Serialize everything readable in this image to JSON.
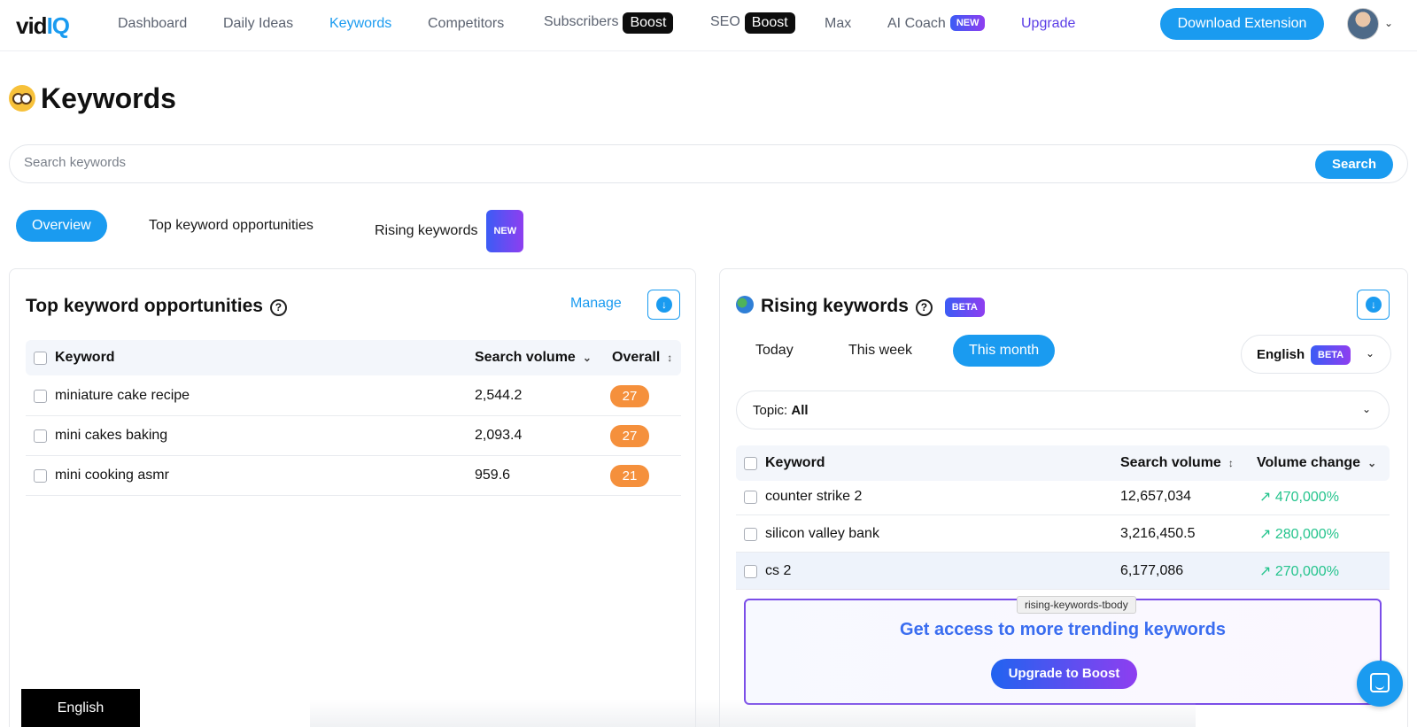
{
  "nav": {
    "logo_a": "vid",
    "logo_b": "IQ",
    "items": [
      {
        "label": "Dashboard"
      },
      {
        "label": "Daily Ideas"
      },
      {
        "label": "Keywords"
      },
      {
        "label": "Competitors"
      },
      {
        "label": "Subscribers",
        "pill": "Boost"
      },
      {
        "label": "SEO",
        "pill": "Boost"
      },
      {
        "label": "Max"
      },
      {
        "label": "AI Coach",
        "pill": "NEW"
      },
      {
        "label": "Upgrade"
      }
    ],
    "download_button": "Download Extension"
  },
  "page": {
    "title": "Keywords"
  },
  "search": {
    "placeholder": "Search keywords",
    "button": "Search"
  },
  "tabs": [
    {
      "label": "Overview",
      "active": true
    },
    {
      "label": "Top keyword opportunities"
    },
    {
      "label": "Rising keywords",
      "pill": "NEW"
    }
  ],
  "left_card": {
    "title": "Top keyword opportunities",
    "help": "?",
    "manage": "Manage",
    "columns": [
      "Keyword",
      "Search volume",
      "Overall"
    ],
    "rows": [
      {
        "keyword": "miniature cake recipe",
        "volume": "2,544.2",
        "score": "27"
      },
      {
        "keyword": "mini cakes baking",
        "volume": "2,093.4",
        "score": "27"
      },
      {
        "keyword": "mini cooking asmr",
        "volume": "959.6",
        "score": "21"
      }
    ]
  },
  "right_card": {
    "title": "Rising keywords",
    "help": "?",
    "beta": "BETA",
    "periods": [
      "Today",
      "This week",
      "This month"
    ],
    "language": {
      "label": "English",
      "beta": "BETA"
    },
    "topic": {
      "label": "Topic:",
      "value": "All"
    },
    "columns": [
      "Keyword",
      "Search volume",
      "Volume change"
    ],
    "rows": [
      {
        "keyword": "counter strike 2",
        "volume": "12,657,034",
        "change": "470,000%"
      },
      {
        "keyword": "silicon valley bank",
        "volume": "3,216,450.5",
        "change": "280,000%"
      },
      {
        "keyword": "cs 2",
        "volume": "6,177,086",
        "change": "270,000%"
      }
    ],
    "tooltip": "rising-keywords-tbody",
    "upsell_text": "Get access to more trending keywords",
    "upsell_button": "Upgrade to Boost"
  },
  "footer": {
    "language": "English"
  },
  "colors": {
    "accent": "#1a9bf0",
    "score": "#f5903c",
    "positive": "#25c48d",
    "upgrade": "#5b3ee6"
  },
  "icons": [
    "help-icon",
    "download-icon",
    "globe-icon",
    "chevron-down-icon",
    "sort-icon",
    "arrow-up-right-icon",
    "chat-icon"
  ]
}
